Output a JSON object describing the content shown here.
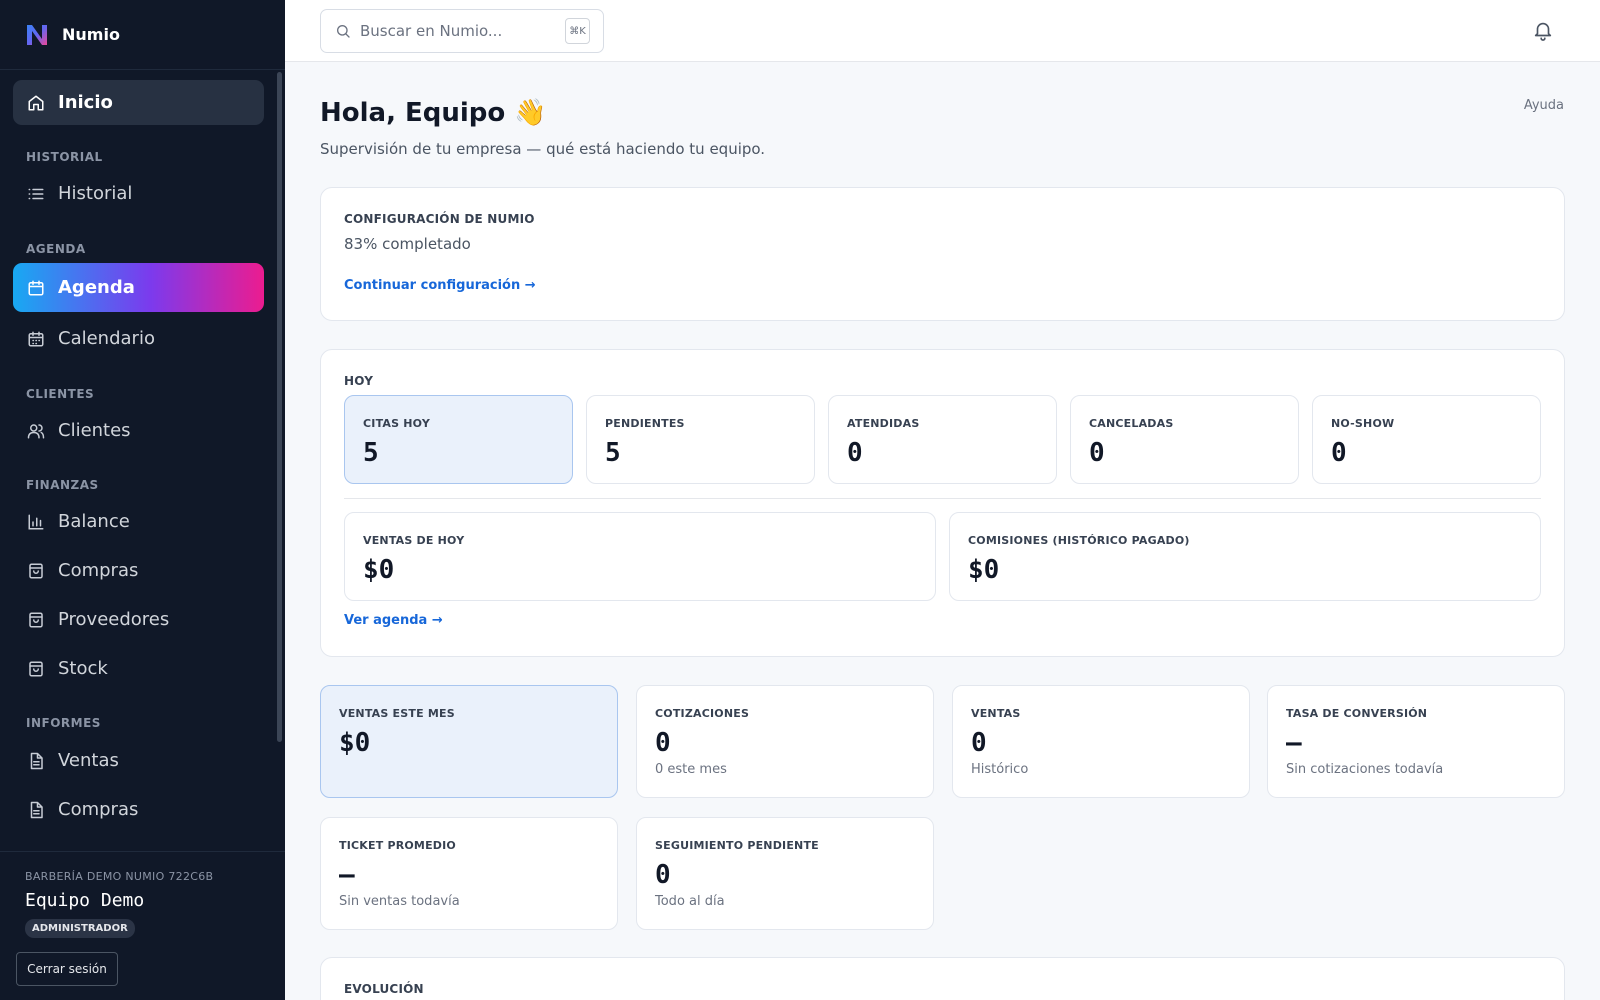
{
  "app": {
    "name": "Numio"
  },
  "sidebar": {
    "home": "Inicio",
    "sections": {
      "historial": "HISTORIAL",
      "agenda": "AGENDA",
      "clientes": "CLIENTES",
      "finanzas": "FINANZAS",
      "informes": "INFORMES"
    },
    "items": {
      "historial": "Historial",
      "agenda": "Agenda",
      "calendario": "Calendario",
      "clientes": "Clientes",
      "balance": "Balance",
      "compras": "Compras",
      "proveedores": "Proveedores",
      "stock": "Stock",
      "ventas_informe": "Ventas",
      "compras_informe": "Compras"
    },
    "footer": {
      "business": "BARBERÍA DEMO NUMIO 722C6B",
      "user": "Equipo Demo",
      "role": "ADMINISTRADOR",
      "logout": "Cerrar sesión"
    }
  },
  "topbar": {
    "search_placeholder": "Buscar en Numio...",
    "shortcut": "⌘K"
  },
  "header": {
    "greeting": "Hola, Equipo 👋",
    "subtitle": "Supervisión de tu empresa — qué está haciendo tu equipo.",
    "help": "Ayuda"
  },
  "setup": {
    "label": "CONFIGURACIÓN DE NUMIO",
    "progress_text": "83% completado",
    "link": "Continuar configuración →"
  },
  "today": {
    "label": "HOY",
    "stats": [
      {
        "label": "CITAS HOY",
        "value": "5"
      },
      {
        "label": "PENDIENTES",
        "value": "5"
      },
      {
        "label": "ATENDIDAS",
        "value": "0"
      },
      {
        "label": "CANCELADAS",
        "value": "0"
      },
      {
        "label": "NO-SHOW",
        "value": "0"
      }
    ],
    "sales_today": {
      "label": "VENTAS DE HOY",
      "value": "$0"
    },
    "commissions": {
      "label": "COMISIONES (HISTÓRICO PAGADO)",
      "value": "$0"
    },
    "link": "Ver agenda →"
  },
  "metrics": [
    {
      "label": "VENTAS ESTE MES",
      "value": "$0",
      "note": ""
    },
    {
      "label": "COTIZACIONES",
      "value": "0",
      "note": "0 este mes"
    },
    {
      "label": "VENTAS",
      "value": "0",
      "note": "Histórico"
    },
    {
      "label": "TASA DE CONVERSIÓN",
      "value": "—",
      "note": "Sin cotizaciones todavía"
    },
    {
      "label": "TICKET PROMEDIO",
      "value": "—",
      "note": "Sin ventas todavía"
    },
    {
      "label": "SEGUIMIENTO PENDIENTE",
      "value": "0",
      "note": "Todo al día"
    }
  ],
  "evolution": {
    "label": "EVOLUCIÓN"
  },
  "colors": {
    "sidebar_bg": "#101828",
    "accent_link": "#1767d9",
    "gradient_start": "#18a9f2",
    "gradient_end": "#ec1c8f",
    "highlight_bg": "#eaf1fb"
  }
}
